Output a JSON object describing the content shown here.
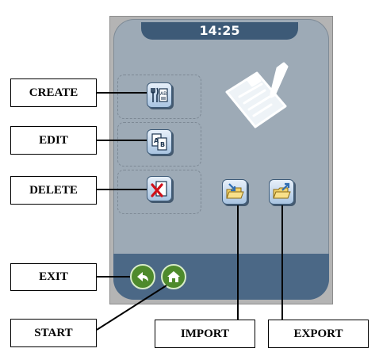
{
  "status": {
    "time": "14:25"
  },
  "labels": {
    "create": "CREATE",
    "edit": "EDIT",
    "delete": "DELETE",
    "exit": "EXIT",
    "start": "START",
    "import": "IMPORT",
    "export": "EXPORT"
  },
  "icons": {
    "create": "recipe-create-icon",
    "edit": "ab-edit-icon",
    "delete": "red-x-delete-icon",
    "import": "folder-import-icon",
    "export": "folder-export-icon",
    "exit": "back-arrow-icon",
    "start": "home-icon",
    "illustration": "clipboard-pen-icon"
  },
  "colors": {
    "screen": "#9daab6",
    "bars": "#3d5a77",
    "button_face": "#c5d8ec",
    "exit_start_buttons": "#4e8a2c",
    "delete_mark": "#d0101a"
  }
}
